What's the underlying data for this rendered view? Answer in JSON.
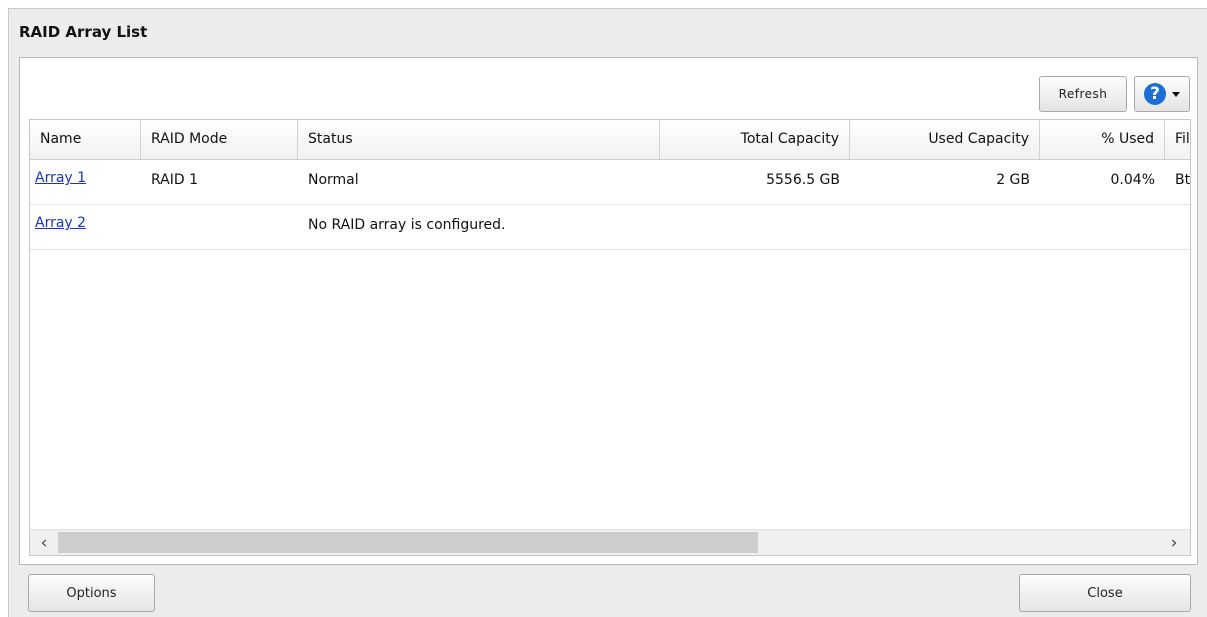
{
  "window": {
    "title": "RAID Array List"
  },
  "toolbar": {
    "refresh_label": "Refresh",
    "help_glyph": "?"
  },
  "table": {
    "columns": [
      "Name",
      "RAID Mode",
      "Status",
      "Total Capacity",
      "Used Capacity",
      "% Used",
      "Fil"
    ],
    "rows": [
      {
        "name": "Array 1",
        "raid_mode": "RAID 1",
        "status": "Normal",
        "total_capacity": "5556.5 GB",
        "used_capacity": "2 GB",
        "percent_used": "0.04%",
        "fs": "Bt"
      },
      {
        "name": "Array 2",
        "raid_mode": "",
        "status": "No RAID array is configured.",
        "total_capacity": "",
        "used_capacity": "",
        "percent_used": "",
        "fs": ""
      }
    ]
  },
  "footer": {
    "options_label": "Options",
    "close_label": "Close"
  },
  "colors": {
    "link": "#1a33cc",
    "help_icon": "#1a6fd6",
    "panel_bg": "#ececec"
  },
  "icons": {
    "help": "help-icon",
    "dropdown": "chevron-down-icon",
    "scroll_left": "chevron-left-icon",
    "scroll_right": "chevron-right-icon"
  }
}
